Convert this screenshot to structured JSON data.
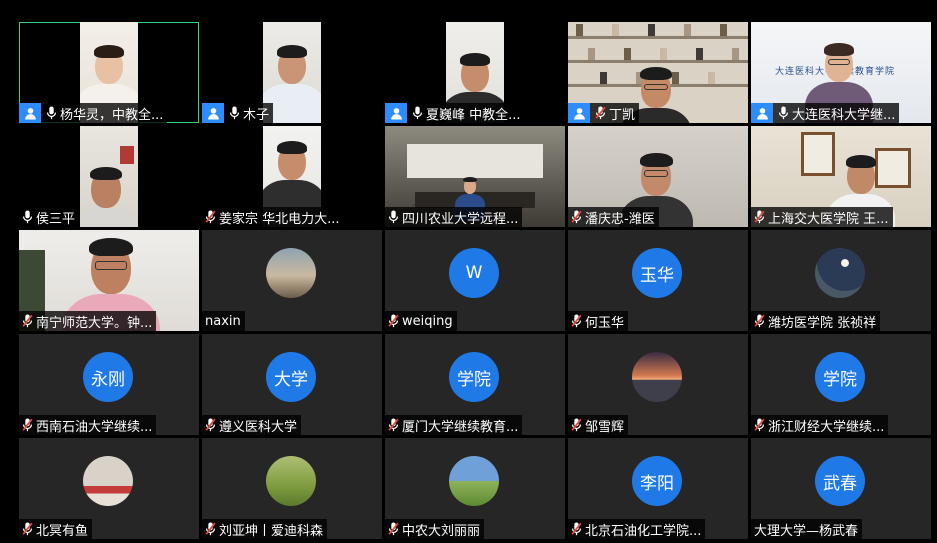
{
  "app": {
    "active_color": "#2fd47a",
    "host_badge_color": "#2d8cff",
    "avatar_color": "#1f7ae8",
    "muted_color": "#e8453c"
  },
  "participants": [
    {
      "name": "杨华灵，中教全...",
      "host": true,
      "mic": "on",
      "tile": "video",
      "active": true,
      "scene": "woman_white"
    },
    {
      "name": "木子",
      "host": true,
      "mic": "on",
      "tile": "video",
      "scene": "man_white"
    },
    {
      "name": "夏巍峰 中教全...",
      "host": true,
      "mic": "on",
      "tile": "video",
      "scene": "man_white2"
    },
    {
      "name": "丁凯",
      "host": true,
      "mic": "muted",
      "tile": "video",
      "scene": "shelves"
    },
    {
      "name": "大连医科大学继...",
      "host": true,
      "mic": "on",
      "tile": "video",
      "scene": "dalian",
      "wall_text": "大连医科大学继续教育学院"
    },
    {
      "name": "侯三平",
      "host": false,
      "mic": "on",
      "tile": "video",
      "scene": "man_hou"
    },
    {
      "name": "姜家宗 华北电力大...",
      "host": false,
      "mic": "muted",
      "tile": "video",
      "scene": "man_white3"
    },
    {
      "name": "四川农业大学远程...",
      "host": false,
      "mic": "on",
      "tile": "video",
      "scene": "room"
    },
    {
      "name": "潘庆忠-潍医",
      "host": false,
      "mic": "muted",
      "tile": "video",
      "scene": "man_glasses"
    },
    {
      "name": "上海交大医学院 王...",
      "host": false,
      "mic": "muted",
      "tile": "video",
      "scene": "frames"
    },
    {
      "name": "南宁师范大学。钟...",
      "host": false,
      "mic": "muted",
      "tile": "video",
      "scene": "man_big"
    },
    {
      "name": "naxin",
      "host": false,
      "mic": "none",
      "tile": "photo",
      "photo": "landscape"
    },
    {
      "name": "weiqing",
      "host": false,
      "mic": "muted",
      "tile": "initials",
      "initials": "W"
    },
    {
      "name": "何玉华",
      "host": false,
      "mic": "muted",
      "tile": "initials",
      "initials": "玉华"
    },
    {
      "name": "潍坊医学院 张祯祥",
      "host": false,
      "mic": "muted",
      "tile": "photo",
      "photo": "moon"
    },
    {
      "name": "西南石油大学继续...",
      "host": false,
      "mic": "muted",
      "tile": "initials",
      "initials": "永刚"
    },
    {
      "name": "遵义医科大学",
      "host": false,
      "mic": "muted",
      "tile": "initials",
      "initials": "大学"
    },
    {
      "name": "厦门大学继续教育...",
      "host": false,
      "mic": "muted",
      "tile": "initials",
      "initials": "学院"
    },
    {
      "name": "邹雪辉",
      "host": false,
      "mic": "muted",
      "tile": "photo",
      "photo": "sunset"
    },
    {
      "name": "浙江财经大学继续...",
      "host": false,
      "mic": "muted",
      "tile": "initials",
      "initials": "学院"
    },
    {
      "name": "北冥有鱼",
      "host": false,
      "mic": "muted",
      "tile": "photo",
      "photo": "girl"
    },
    {
      "name": "刘亚坤丨爱迪科森",
      "host": false,
      "mic": "muted",
      "tile": "photo",
      "photo": "grass"
    },
    {
      "name": "中农大刘丽丽",
      "host": false,
      "mic": "muted",
      "tile": "photo",
      "photo": "field"
    },
    {
      "name": "北京石油化工学院...",
      "host": false,
      "mic": "muted",
      "tile": "initials",
      "initials": "李阳"
    },
    {
      "name": "大理大学—杨武春",
      "host": false,
      "mic": "none",
      "tile": "initials",
      "initials": "武春"
    }
  ]
}
